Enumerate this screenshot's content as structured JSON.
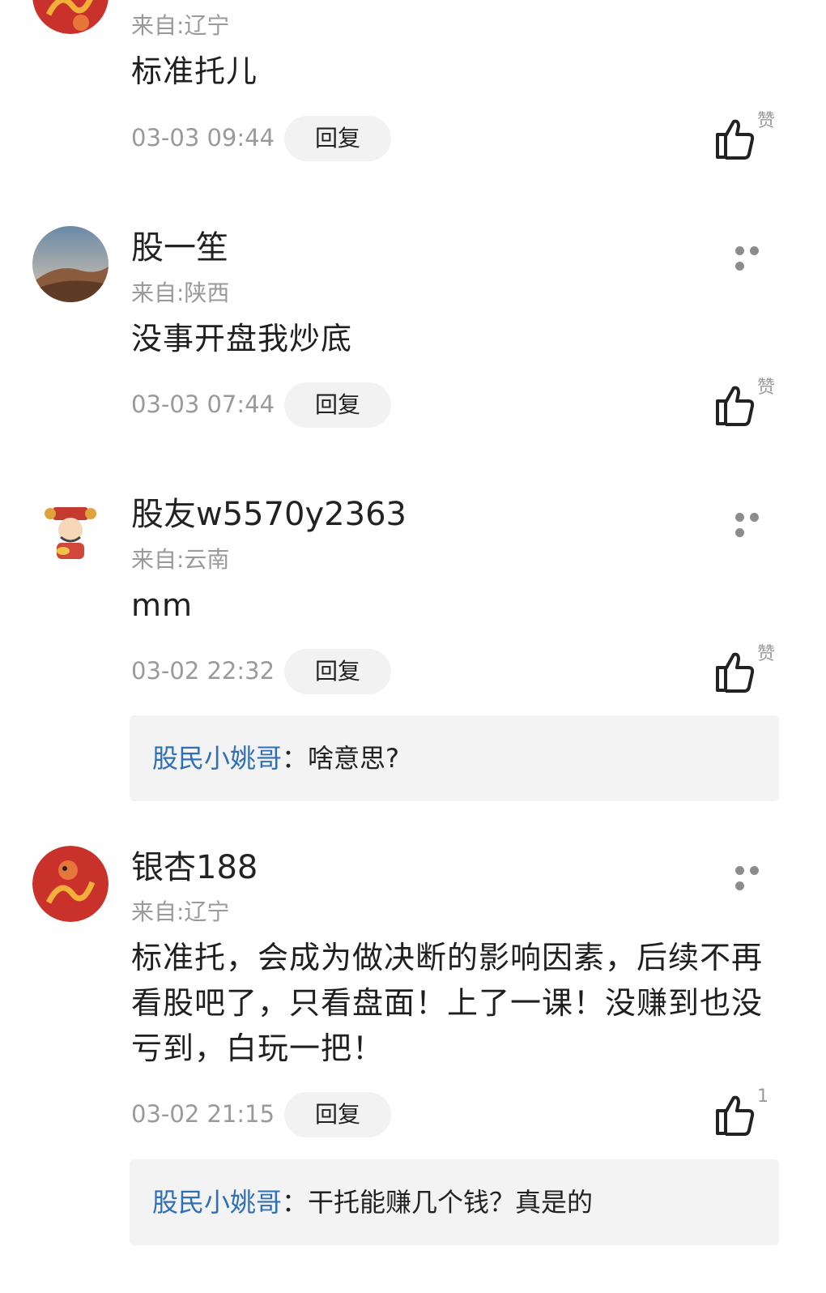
{
  "common": {
    "reply_label": "回复",
    "like_label": "赞"
  },
  "comments": [
    {
      "username": "",
      "location": "来自:辽宁",
      "content": "标准托儿",
      "time": "03-03 09:44",
      "like_display": "赞",
      "avatar": "dragon-icon"
    },
    {
      "username": "股一笙",
      "location": "来自:陕西",
      "content": "没事开盘我炒底",
      "time": "03-03 07:44",
      "like_display": "赞",
      "avatar": "desert-icon"
    },
    {
      "username": "股友w5570y2363",
      "location": "来自:云南",
      "content": "mm",
      "time": "03-02 22:32",
      "like_display": "赞",
      "avatar": "fortune-god-icon",
      "sub_reply": {
        "author": "股民小姚哥",
        "separator": "：",
        "text": "啥意思?"
      }
    },
    {
      "username": "银杏188",
      "location": "来自:辽宁",
      "content": "标准托，会成为做决断的影响因素，后续不再看股吧了，只看盘面！上了一课！没赚到也没亏到，白玩一把！",
      "time": "03-02 21:15",
      "like_display": "1",
      "avatar": "dragon-icon",
      "sub_reply": {
        "author": "股民小姚哥",
        "separator": "：",
        "text": "干托能赚几个钱？真是的"
      }
    }
  ],
  "colors": {
    "link": "#2e6fb5",
    "muted": "#9a9a9a",
    "reply_bg": "#f2f2f2"
  }
}
